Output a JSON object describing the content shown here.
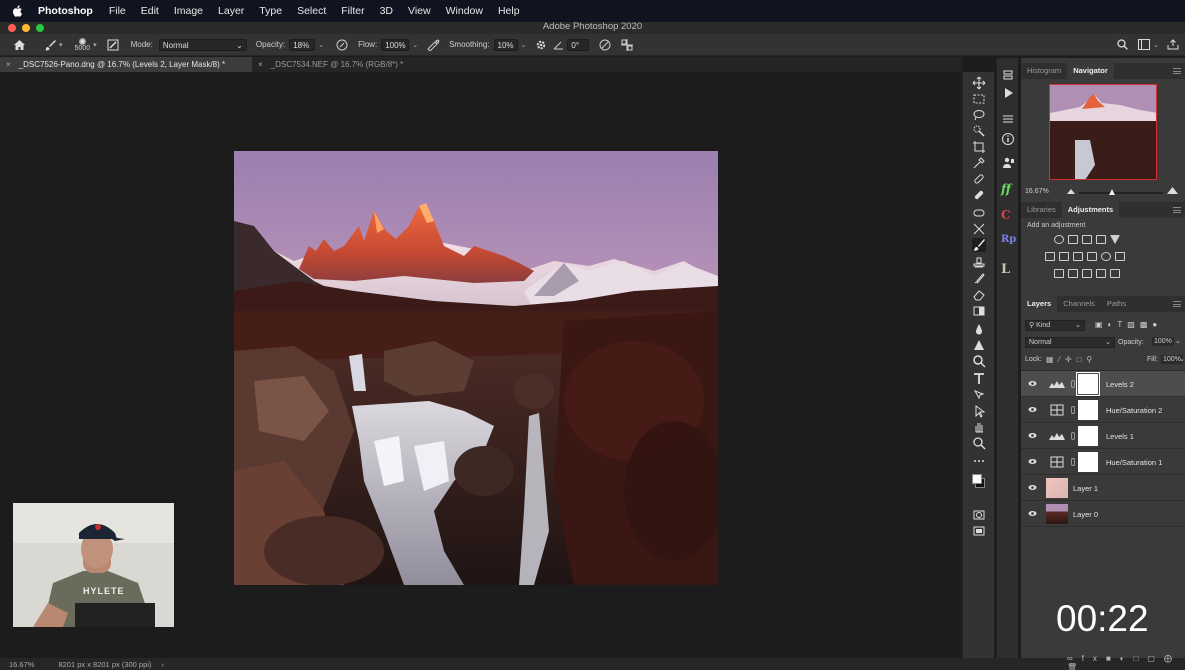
{
  "menubar": {
    "app_name": "Photoshop",
    "menus": [
      "File",
      "Edit",
      "Image",
      "Layer",
      "Type",
      "Select",
      "Filter",
      "3D",
      "View",
      "Window",
      "Help"
    ]
  },
  "window": {
    "title": "Adobe Photoshop 2020"
  },
  "options": {
    "brush_size": "5000",
    "mode_label": "Mode:",
    "mode_value": "Normal",
    "opacity_label": "Opacity:",
    "opacity_value": "18%",
    "flow_label": "Flow:",
    "flow_value": "100%",
    "smoothing_label": "Smoothing:",
    "smoothing_value": "10%",
    "angle_value": "0°"
  },
  "tabs": [
    {
      "label": "_DSC7526-Pano.dng @ 16.7% (Levels 2, Layer Mask/8) *"
    },
    {
      "label": "_DSC7534.NEF @ 16.7% (RGB/8*) *"
    }
  ],
  "panels": {
    "top_tabs": [
      "Histogram",
      "Navigator"
    ],
    "navigator_zoom": "16.67%",
    "mid_tabs": [
      "Libraries",
      "Adjustments"
    ],
    "add_adjustment_label": "Add an adjustment",
    "layer_tabs": [
      "Layers",
      "Channels",
      "Paths"
    ],
    "filter_kind": "Kind",
    "blend_mode": "Normal",
    "opacity_label": "Opacity:",
    "opacity_value": "100%",
    "lock_label": "Lock:",
    "fill_label": "Fill:",
    "fill_value": "100%",
    "layers": [
      {
        "name": "Levels 2",
        "type": "levels"
      },
      {
        "name": "Hue/Saturation 2",
        "type": "huesat"
      },
      {
        "name": "Levels 1",
        "type": "levels"
      },
      {
        "name": "Hue/Saturation 1",
        "type": "huesat"
      },
      {
        "name": "Layer 1",
        "type": "pixel-pink"
      },
      {
        "name": "Layer 0",
        "type": "pixel-photo"
      }
    ]
  },
  "status": {
    "zoom": "16.67%",
    "doc_info": "8201 px x 8201 px (300 ppi)"
  },
  "webcam": {
    "shirt_text": "HYLETE"
  },
  "timer": "00:22",
  "colors": {
    "menubar_bg": "#0f1420",
    "panel_bg": "#3a3a3a",
    "canvas_bg": "#1c1c1c",
    "selected_layer": "#4d4d4d",
    "close_red": "#fe5f57",
    "minimize_yellow": "#febc2e",
    "zoom_green": "#28c840"
  }
}
